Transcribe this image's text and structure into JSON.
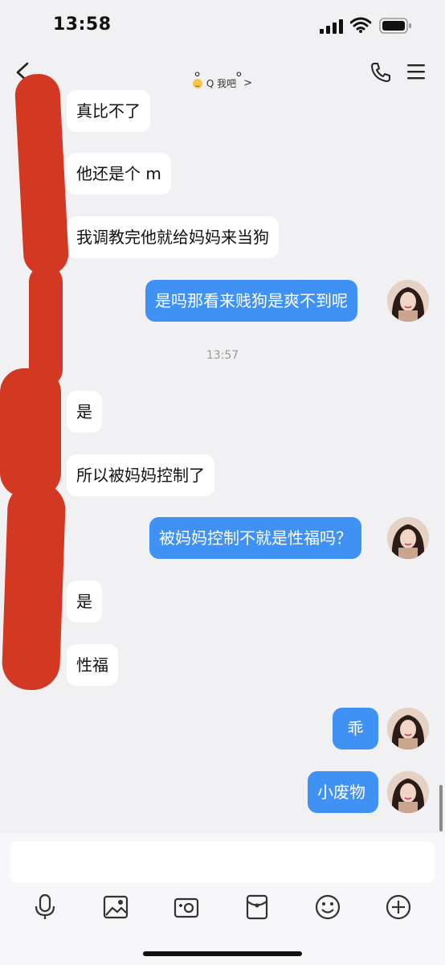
{
  "status_bar": {
    "time": "13:58"
  },
  "header": {
    "title": "。 。",
    "subtitle": "Q 我吧",
    "subtitle_chevron": ">"
  },
  "messages": [
    {
      "side": "left",
      "text": "真比不了"
    },
    {
      "side": "left",
      "text": "他还是个 m"
    },
    {
      "side": "left",
      "text": "我调教完他就给妈妈来当狗"
    },
    {
      "side": "right",
      "text": "是吗那看来贱狗是爽不到呢"
    },
    {
      "side": "left",
      "text": "是"
    },
    {
      "side": "left",
      "text": "所以被妈妈控制了"
    },
    {
      "side": "right",
      "text": "被妈妈控制不就是性福吗？"
    },
    {
      "side": "left",
      "text": "是"
    },
    {
      "side": "left",
      "text": "性福"
    },
    {
      "side": "right",
      "text": "乖"
    },
    {
      "side": "right",
      "text": "小废物"
    }
  ],
  "timestamp": "13:57",
  "toolbar": {
    "icons": [
      "microphone-icon",
      "image-icon",
      "camera-icon",
      "red-packet-icon",
      "emoji-icon",
      "plus-icon"
    ]
  },
  "colors": {
    "outgoing_bubble": "#3f91f3",
    "incoming_bubble": "#ffffff",
    "background": "#f1f1f3",
    "redaction": "#d33823"
  }
}
